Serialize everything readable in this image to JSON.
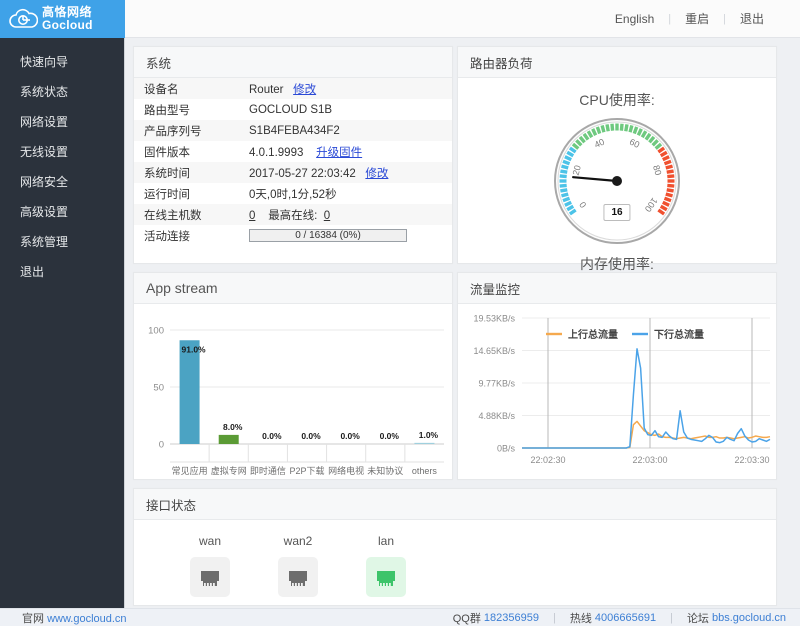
{
  "header": {
    "logo_cn": "高恪网络",
    "logo_en": "Gocloud",
    "logo_icon": "cloud-logo-icon",
    "links": [
      {
        "label": "English",
        "name": "language-toggle"
      },
      {
        "label": "重启",
        "name": "reboot-button"
      },
      {
        "label": "退出",
        "name": "logout-button"
      }
    ],
    "separator": "|"
  },
  "sidebar": {
    "items": [
      {
        "label": "快速向导",
        "name": "sidebar-item-quick-wizard"
      },
      {
        "label": "系统状态",
        "name": "sidebar-item-system-status"
      },
      {
        "label": "网络设置",
        "name": "sidebar-item-network-settings"
      },
      {
        "label": "无线设置",
        "name": "sidebar-item-wireless-settings"
      },
      {
        "label": "网络安全",
        "name": "sidebar-item-network-security"
      },
      {
        "label": "高级设置",
        "name": "sidebar-item-advanced-settings"
      },
      {
        "label": "系统管理",
        "name": "sidebar-item-system-management"
      },
      {
        "label": "退出",
        "name": "sidebar-item-logout"
      }
    ]
  },
  "system_panel": {
    "title": "系统",
    "rows": [
      {
        "key": "设备名",
        "value": "Router",
        "link": "修改"
      },
      {
        "key": "路由型号",
        "value": "GOCLOUD S1B",
        "link": ""
      },
      {
        "key": "产品序列号",
        "value": "S1B4FEBA434F2",
        "link": ""
      },
      {
        "key": "固件版本",
        "value": "4.0.1.9993",
        "link": "升级固件"
      },
      {
        "key": "系统时间",
        "value": "2017-05-27 22:03:42",
        "link": "修改"
      },
      {
        "key": "运行时间",
        "value": "0天,0时,1分,52秒",
        "link": ""
      }
    ],
    "hosts_row": {
      "key": "在线主机数",
      "online": "0",
      "max_label": "最高在线:",
      "max_value": "0"
    },
    "conn_row": {
      "key": "活动连接",
      "bar_text": "0 / 16384 (0%)",
      "percent": 0
    }
  },
  "load_panel": {
    "title": "路由器负荷",
    "cpu_label": "CPU使用率:",
    "mem_label": "内存使用率:",
    "gauge": {
      "value": 16,
      "min": 0,
      "max": 100,
      "ticks": [
        0,
        20,
        40,
        60,
        80,
        100
      ],
      "band_colors": {
        "low": "#4cc3e8",
        "mid": "#6ec97f",
        "high": "#f0502f"
      },
      "low_end": 30,
      "mid_end": 70
    }
  },
  "chart_data": [
    {
      "type": "bar",
      "panel_title": "App stream",
      "title": "",
      "categories": [
        "常见应用",
        "虚拟专网",
        "即时通信",
        "P2P下载",
        "网络电视",
        "未知协议",
        "others"
      ],
      "values": [
        91.0,
        8.0,
        0.0,
        0.0,
        0.0,
        0.0,
        1.0
      ],
      "labels": [
        "91.0%",
        "8.0%",
        "0.0%",
        "0.0%",
        "0.0%",
        "0.0%",
        "1.0%"
      ],
      "colors": [
        "#4ba3c3",
        "#5b9b35",
        "#4ba3c3",
        "#4ba3c3",
        "#4ba3c3",
        "#4ba3c3",
        "#9fd0de"
      ],
      "xlabel": "",
      "ylabel": "",
      "yticks": [
        0,
        50,
        100
      ],
      "ytick_labels": [
        "0",
        "50",
        "100"
      ],
      "ylim": [
        0,
        100
      ],
      "grid": true,
      "legend": "none"
    },
    {
      "type": "line",
      "panel_title": "流量监控",
      "title": "",
      "legend": [
        "上行总流量",
        "下行总流量"
      ],
      "legend_colors": [
        "#f5a94e",
        "#4ba3e8"
      ],
      "legend_position": "top-center",
      "xlabel": "",
      "ylabel": "",
      "xtick_labels": [
        "22:02:30",
        "22:03:00",
        "22:03:30"
      ],
      "ytick_labels": [
        "0B/s",
        "4.88KB/s",
        "9.77KB/s",
        "14.65KB/s",
        "19.53KB/s"
      ],
      "ylim": [
        0,
        19.53
      ],
      "yunit": "KB/s",
      "grid": true,
      "series": [
        {
          "name": "上行总流量",
          "color": "#f5a94e",
          "values": [
            0,
            0,
            0,
            0,
            0,
            0,
            0,
            0,
            0,
            0,
            0,
            0,
            0,
            0,
            0,
            0,
            0,
            0,
            0,
            0,
            0,
            0,
            0,
            0,
            0,
            0,
            0,
            0,
            0,
            0,
            0.1,
            3.5,
            4.0,
            3.3,
            2.6,
            2.3,
            2.0,
            1.9,
            2.1,
            1.7,
            1.6,
            1.6,
            1.5,
            1.4,
            1.5,
            1.6,
            1.5,
            1.4,
            1.5,
            1.6,
            1.7,
            1.8,
            1.6,
            1.6,
            1.7,
            1.5,
            1.5,
            1.6,
            1.5,
            1.4,
            1.5,
            1.6,
            1.7,
            1.5,
            1.6,
            1.8,
            1.7,
            1.6,
            1.6,
            1.7
          ]
        },
        {
          "name": "下行总流量",
          "color": "#4ba3e8",
          "values": [
            0,
            0,
            0,
            0,
            0,
            0,
            0,
            0,
            0,
            0,
            0,
            0,
            0,
            0,
            0,
            0,
            0,
            0,
            0,
            0,
            0,
            0,
            0,
            0,
            0,
            0,
            0,
            0,
            0,
            0,
            0.2,
            8.0,
            14.9,
            12.0,
            3.0,
            2.0,
            1.9,
            2.6,
            1.7,
            1.6,
            2.4,
            1.8,
            1.4,
            1.3,
            5.6,
            2.4,
            1.5,
            1.3,
            1.2,
            1.1,
            1.0,
            1.4,
            1.9,
            1.6,
            0.9,
            0.8,
            1.0,
            1.6,
            1.3,
            1.1,
            2.2,
            2.9,
            1.8,
            1.2,
            0.9,
            1.0,
            1.4,
            1.2,
            1.0,
            1.3
          ]
        }
      ]
    }
  ],
  "interface_panel": {
    "title": "接口状态",
    "ports": [
      {
        "label": "wan",
        "state": "off",
        "icon": "ethernet-port-icon"
      },
      {
        "label": "wan2",
        "state": "off",
        "icon": "ethernet-port-icon"
      },
      {
        "label": "lan",
        "state": "on",
        "icon": "ethernet-port-icon"
      }
    ]
  },
  "footer": {
    "site_label": "官网",
    "site_url": "www.gocloud.cn",
    "qq_label": "QQ群",
    "qq_value": "182356959",
    "hotline_label": "热线",
    "hotline_value": "4006665691",
    "forum_label": "论坛",
    "forum_url": "bbs.gocloud.cn",
    "separator": "|"
  },
  "theme": {
    "brand_blue": "#3fa2e8",
    "sidebar_bg": "#2b323c",
    "page_bg": "#eef0f3",
    "link_blue": "#2b4ad6"
  }
}
